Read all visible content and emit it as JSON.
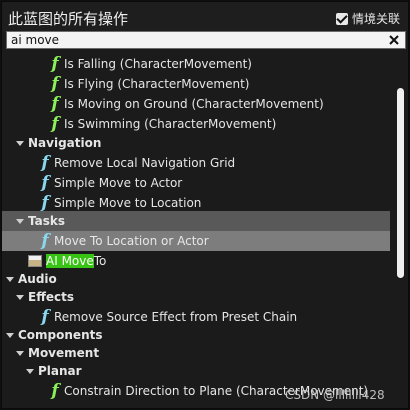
{
  "header": {
    "title": "此蓝图的所有操作",
    "context_label": "情境关联",
    "context_checked": true
  },
  "search": {
    "value": "ai move",
    "placeholder": ""
  },
  "list": {
    "characterMovementItems": [
      "Is Falling (CharacterMovement)",
      "Is Flying (CharacterMovement)",
      "Is Moving on Ground (CharacterMovement)",
      "Is Swimming (CharacterMovement)"
    ],
    "navigation": {
      "label": "Navigation",
      "items": [
        "Remove Local Navigation Grid",
        "Simple Move to Actor",
        "Simple Move to Location"
      ]
    },
    "tasks": {
      "label": "Tasks",
      "item": "Move To Location or Actor",
      "node_highlight": "AI Move",
      "node_rest": "To"
    },
    "audio": {
      "label": "Audio",
      "effects_label": "Effects",
      "effects_item": "Remove Source Effect from Preset Chain"
    },
    "components": {
      "label": "Components",
      "movement_label": "Movement",
      "planar_label": "Planar",
      "planar_item": "Constrain Direction to Plane (CharacterMovement)"
    }
  },
  "watermark": "CSDN @llllllll428"
}
